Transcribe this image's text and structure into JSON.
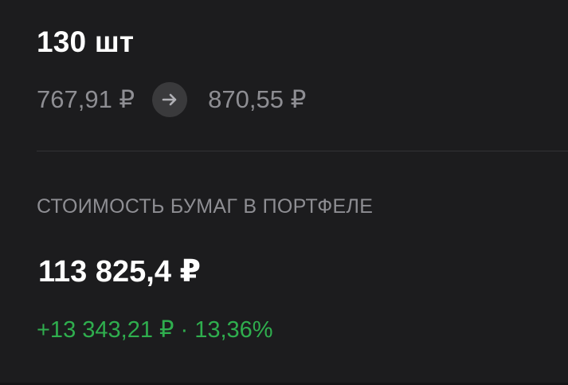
{
  "position": {
    "quantity": "130 шт",
    "price_from": "767,91 ₽",
    "price_to": "870,55 ₽"
  },
  "portfolio": {
    "section_label": "СТОИМОСТЬ БУМАГ В ПОРТФЕЛЕ",
    "value": "113 825,4 ₽",
    "change": "+13 343,21 ₽ · 13,36%"
  },
  "icons": {
    "arrow": "arrow-right-icon"
  },
  "colors": {
    "background": "#1c1c1e",
    "primary_text": "#ffffff",
    "secondary_text": "#8e8e93",
    "positive": "#2fae4e",
    "arrow_circle": "#3a3a3c"
  }
}
